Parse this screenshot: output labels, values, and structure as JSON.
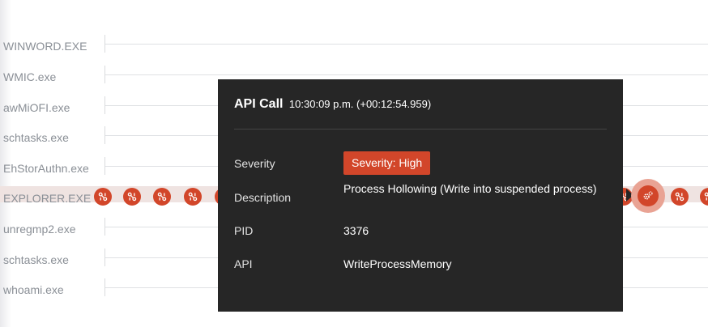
{
  "processes": [
    {
      "name": "WINWORD.EXE"
    },
    {
      "name": "WMIC.exe"
    },
    {
      "name": "awMiOFI.exe"
    },
    {
      "name": "schtasks.exe"
    },
    {
      "name": "EhStorAuthn.exe"
    },
    {
      "name": "EXPLORER.EXE",
      "active": true
    },
    {
      "name": "unregmp2.exe"
    },
    {
      "name": "schtasks.exe"
    },
    {
      "name": "whoami.exe"
    }
  ],
  "event_icon": "api-call-icon",
  "selected_event_icon": "gears-icon",
  "colors": {
    "accent": "#d2462a",
    "popup_bg": "#262626",
    "halo": "#e9a394"
  },
  "popup": {
    "title": "API Call",
    "time": "10:30:09 p.m. (+00:12:54.959)",
    "fields": {
      "severity_label": "Severity",
      "severity_value": "Severity: High",
      "description_label": "Description",
      "description_value": "Process Hollowing (Write into suspended process)",
      "pid_label": "PID",
      "pid_value": "3376",
      "api_label": "API",
      "api_value": "WriteProcessMemory"
    }
  }
}
